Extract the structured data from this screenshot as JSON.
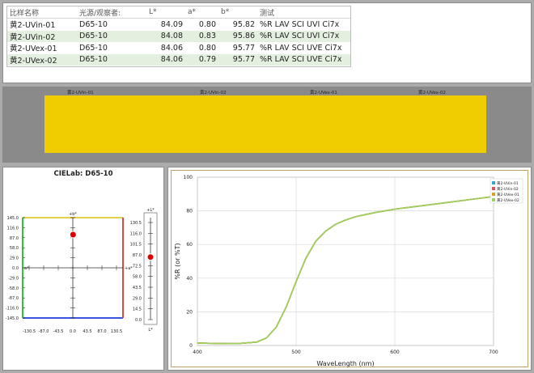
{
  "table": {
    "headers": [
      "比样名称",
      "光源/观察者:",
      "L*",
      "a*",
      "b*",
      "测试"
    ],
    "rows": [
      {
        "name": "黄2-UVin-01",
        "illum": "D65-10",
        "L": "84.09",
        "a": "0.80",
        "b": "95.82",
        "test": "%R LAV SCI UVI Ci7x"
      },
      {
        "name": "黄2-UVin-02",
        "illum": "D65-10",
        "L": "84.08",
        "a": "0.83",
        "b": "95.86",
        "test": "%R LAV SCI UVI Ci7x"
      },
      {
        "name": "黄2-UVex-01",
        "illum": "D65-10",
        "L": "84.06",
        "a": "0.80",
        "b": "95.77",
        "test": "%R LAV SCI UVE Ci7x"
      },
      {
        "name": "黄2-UVex-02",
        "illum": "D65-10",
        "L": "84.06",
        "a": "0.79",
        "b": "95.77",
        "test": "%R LAV SCI UVE Ci7x"
      }
    ]
  },
  "swatch": {
    "color": "#f0cd00",
    "labels": [
      "黄2-UVin-01",
      "黄2-UVin-02",
      "黄2-UVex-01",
      "黄2-UVex-02"
    ]
  },
  "cielab": {
    "title": "CIELab: D65-10",
    "b_axis_label": "+b*",
    "a_axis_label": "+a*",
    "neg_a_label": "a*",
    "ab_y_ticks": [
      "145.0",
      "116.0",
      "87.0",
      "58.0",
      "29.0",
      "0.0",
      "-29.0",
      "-58.0",
      "-87.0",
      "-116.0",
      "-145.0"
    ],
    "ab_x_ticks": [
      "-130.5",
      "-87.0",
      "-43.5",
      "0.0",
      "43.5",
      "87.0",
      "130.5"
    ],
    "L_top_label": "+L*",
    "L_bottom_label": "L*",
    "L_ticks": [
      "130.5",
      "116.0",
      "101.5",
      "87.0",
      "72.5",
      "58.0",
      "43.5",
      "29.0",
      "14.5",
      "0.0"
    ],
    "point_color": "#dd0000"
  },
  "chart_data": {
    "type": "line",
    "title": "",
    "xlabel": "WaveLength (nm)",
    "ylabel": "%R (or %T)",
    "xlim": [
      400,
      700
    ],
    "ylim": [
      0,
      100
    ],
    "x_ticks": [
      400,
      500,
      600,
      700
    ],
    "y_ticks": [
      0,
      20,
      40,
      60,
      80,
      100
    ],
    "legend_position": "top-right",
    "series": [
      {
        "name": "黄2-UVin-01",
        "color": "#2fa8d8",
        "x": [
          400,
          420,
          440,
          460,
          470,
          480,
          490,
          500,
          510,
          520,
          530,
          540,
          550,
          560,
          580,
          600,
          620,
          640,
          660,
          680,
          700
        ],
        "y": [
          1.5,
          1.2,
          1.1,
          2.0,
          4.5,
          11,
          23,
          38,
          52,
          62,
          68,
          72,
          74.5,
          76.5,
          79,
          81,
          82.5,
          84,
          85.5,
          87,
          88.5
        ]
      },
      {
        "name": "黄2-UVin-02",
        "color": "#e0505a",
        "x": [
          400,
          420,
          440,
          460,
          470,
          480,
          490,
          500,
          510,
          520,
          530,
          540,
          550,
          560,
          580,
          600,
          620,
          640,
          660,
          680,
          700
        ],
        "y": [
          1.5,
          1.2,
          1.1,
          2.0,
          4.5,
          11,
          23,
          38,
          52,
          62,
          68,
          72,
          74.5,
          76.5,
          79,
          81,
          82.5,
          84,
          85.5,
          87,
          88.5
        ]
      },
      {
        "name": "黄2-UVex-01",
        "color": "#d9a21e",
        "x": [
          400,
          420,
          440,
          460,
          470,
          480,
          490,
          500,
          510,
          520,
          530,
          540,
          550,
          560,
          580,
          600,
          620,
          640,
          660,
          680,
          700
        ],
        "y": [
          1.5,
          1.2,
          1.1,
          2.0,
          4.5,
          11,
          23,
          38,
          52,
          62,
          68,
          72,
          74.5,
          76.5,
          79,
          81,
          82.5,
          84,
          85.5,
          87,
          88.5
        ]
      },
      {
        "name": "黄2-UVex-02",
        "color": "#9ad25c",
        "x": [
          400,
          420,
          440,
          460,
          470,
          480,
          490,
          500,
          510,
          520,
          530,
          540,
          550,
          560,
          580,
          600,
          620,
          640,
          660,
          680,
          700
        ],
        "y": [
          1.5,
          1.2,
          1.1,
          2.0,
          4.5,
          11,
          23,
          38,
          52,
          62,
          68,
          72,
          74.5,
          76.5,
          79,
          81,
          82.5,
          84,
          85.5,
          87,
          88.5
        ]
      }
    ]
  }
}
